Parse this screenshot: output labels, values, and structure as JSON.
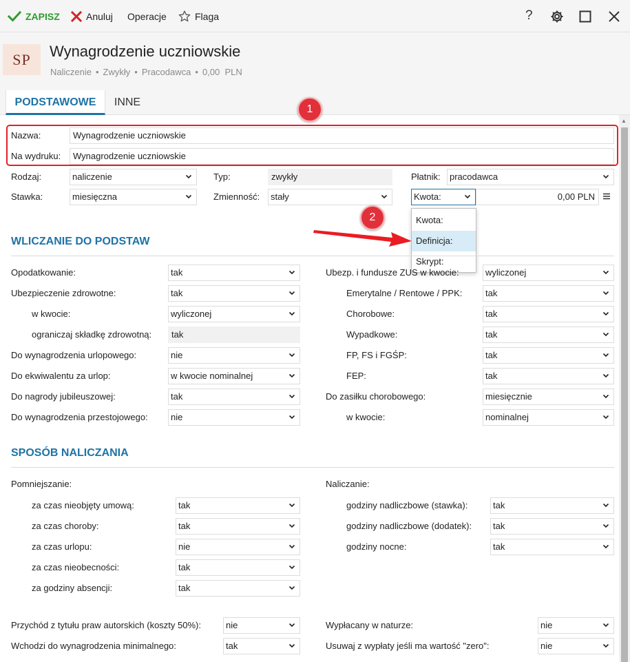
{
  "toolbar": {
    "save": "ZAPISZ",
    "cancel": "Anuluj",
    "operations": "Operacje",
    "flag": "Flaga"
  },
  "header": {
    "logo": "SP",
    "title": "Wynagrodzenie uczniowskie",
    "subtitle": [
      "Naliczenie",
      "Zwykły",
      "Pracodawca",
      "0,00  PLN"
    ]
  },
  "tabs": [
    "PODSTAWOWE",
    "INNE"
  ],
  "colors": {
    "accent": "#1e73a5",
    "annotation_red": "#e22126",
    "save_green": "#2e9b2e",
    "cancel_red": "#d0242a"
  },
  "badges": [
    "1",
    "2"
  ],
  "basic": {
    "name_label": "Nazwa:",
    "name_value": "Wynagrodzenie uczniowskie",
    "print_label": "Na wydruku:",
    "print_value": "Wynagrodzenie uczniowskie",
    "kind_label": "Rodzaj:",
    "kind_value": "naliczenie",
    "type_label": "Typ:",
    "type_value": "zwykły",
    "payer_label": "Płatnik:",
    "payer_value": "pracodawca",
    "rate_label": "Stawka:",
    "rate_value": "miesięczna",
    "variability_label": "Zmienność:",
    "variability_value": "stały",
    "amount_select": "Kwota:",
    "amount_value": "0,00 PLN",
    "amount_options": [
      "Kwota:",
      "Definicja:",
      "Skrypt:"
    ]
  },
  "section1": {
    "title": "WLICZANIE DO PODSTAW",
    "left": [
      {
        "label": "Opodatkowanie:",
        "value": "tak"
      },
      {
        "label": "Ubezpieczenie zdrowotne:",
        "value": "tak"
      },
      {
        "label": "w kwocie:",
        "value": "wyliczonej"
      },
      {
        "label": "ograniczaj składkę zdrowotną:",
        "value": "tak"
      },
      {
        "label": "Do wynagrodzenia urlopowego:",
        "value": "nie"
      },
      {
        "label": "Do ekwiwalentu za urlop:",
        "value": "w kwocie nominalnej"
      },
      {
        "label": "Do nagrody jubileuszowej:",
        "value": "tak"
      },
      {
        "label": "Do wynagrodzenia przestojowego:",
        "value": "nie"
      }
    ],
    "right": [
      {
        "label": "Ubezp. i fundusze ZUS w kwocie:",
        "value": "wyliczonej"
      },
      {
        "label": "Emerytalne / Rentowe / PPK:",
        "value": "tak"
      },
      {
        "label": "Chorobowe:",
        "value": "tak"
      },
      {
        "label": "Wypadkowe:",
        "value": "tak"
      },
      {
        "label": "FP, FS i FGŚP:",
        "value": "tak"
      },
      {
        "label": "FEP:",
        "value": "tak"
      },
      {
        "label": "Do zasiłku chorobowego:",
        "value": "miesięcznie"
      },
      {
        "label": "w kwocie:",
        "value": "nominalnej"
      }
    ]
  },
  "section2": {
    "title": "SPOSÓB NALICZANIA",
    "left_heading": "Pomniejszanie:",
    "left": [
      {
        "label": "za czas nieobjęty umową:",
        "value": "tak"
      },
      {
        "label": "za czas choroby:",
        "value": "tak"
      },
      {
        "label": "za czas urlopu:",
        "value": "nie"
      },
      {
        "label": "za czas nieobecności:",
        "value": "tak"
      },
      {
        "label": "za godziny absencji:",
        "value": "tak"
      }
    ],
    "right_heading": "Naliczanie:",
    "right": [
      {
        "label": "godziny nadliczbowe (stawka):",
        "value": "tak"
      },
      {
        "label": "godziny nadliczbowe (dodatek):",
        "value": "tak"
      },
      {
        "label": "godziny nocne:",
        "value": "tak"
      }
    ]
  },
  "bottom": {
    "copyright_label": "Przychód z tytułu praw autorskich (koszty 50%):",
    "copyright_value": "nie",
    "minimum_label": "Wchodzi do wynagrodzenia minimalnego:",
    "minimum_value": "tak",
    "in_kind_label": "Wypłacany w naturze:",
    "in_kind_value": "nie",
    "zero_label": "Usuwaj z wypłaty jeśli ma wartość \"zero\":",
    "zero_value": "nie"
  }
}
